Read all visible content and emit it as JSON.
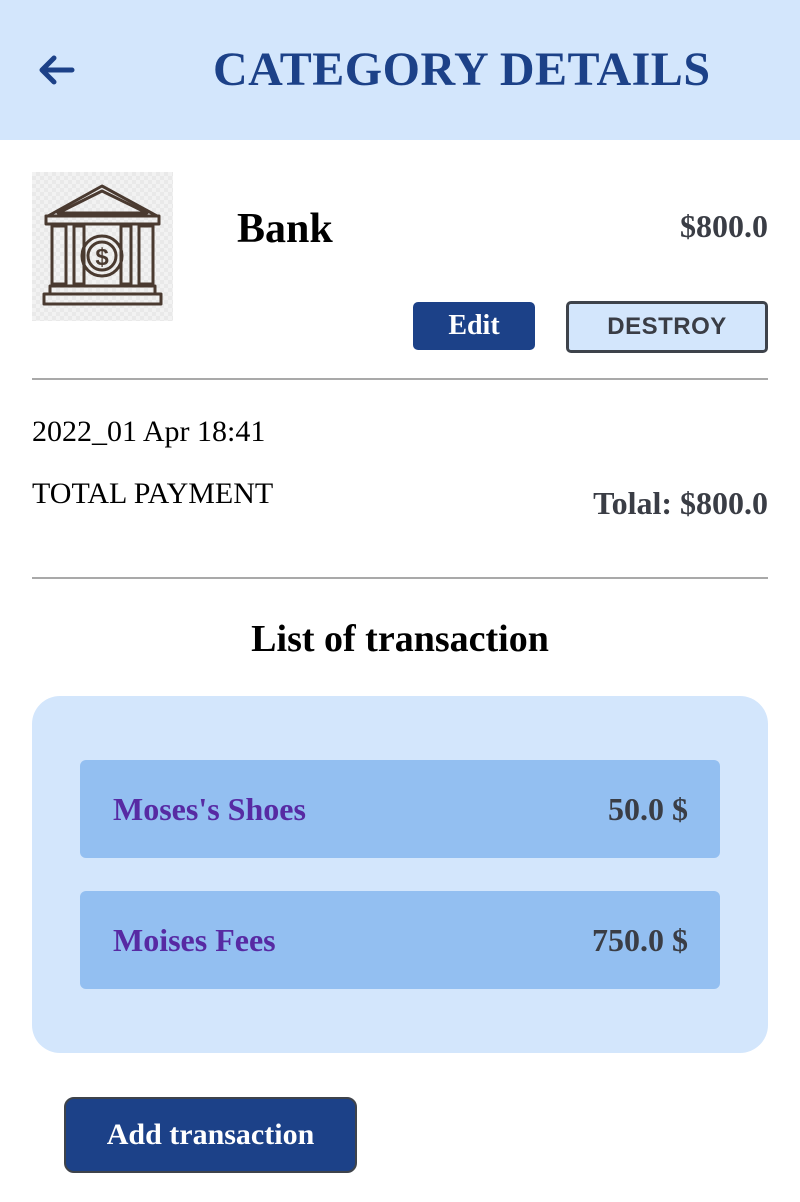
{
  "header": {
    "title": "CATEGORY DETAILS",
    "back_icon": "arrow-left-icon",
    "background_color": "#d3e6fc",
    "title_color": "#1c4188"
  },
  "category": {
    "icon": "bank-icon",
    "name": "Bank",
    "amount": "$800.0",
    "edit_label": "Edit",
    "destroy_label": "DESTROY",
    "date": "2022_01 Apr 18:41",
    "total_label": "TOTAL PAYMENT",
    "total_value": "Tolal: $800.0"
  },
  "transactions": {
    "title": "List of transaction",
    "items": [
      {
        "name": "Moses's Shoes",
        "amount": "50.0 $"
      },
      {
        "name": "Moises Fees",
        "amount": "750.0 $"
      }
    ],
    "add_label": "Add transaction"
  },
  "colors": {
    "primary": "#1c4188",
    "panel": "#d3e6fc",
    "item": "#93bff1",
    "item_name": "#572aa3",
    "amount_text": "#3a3d45"
  }
}
